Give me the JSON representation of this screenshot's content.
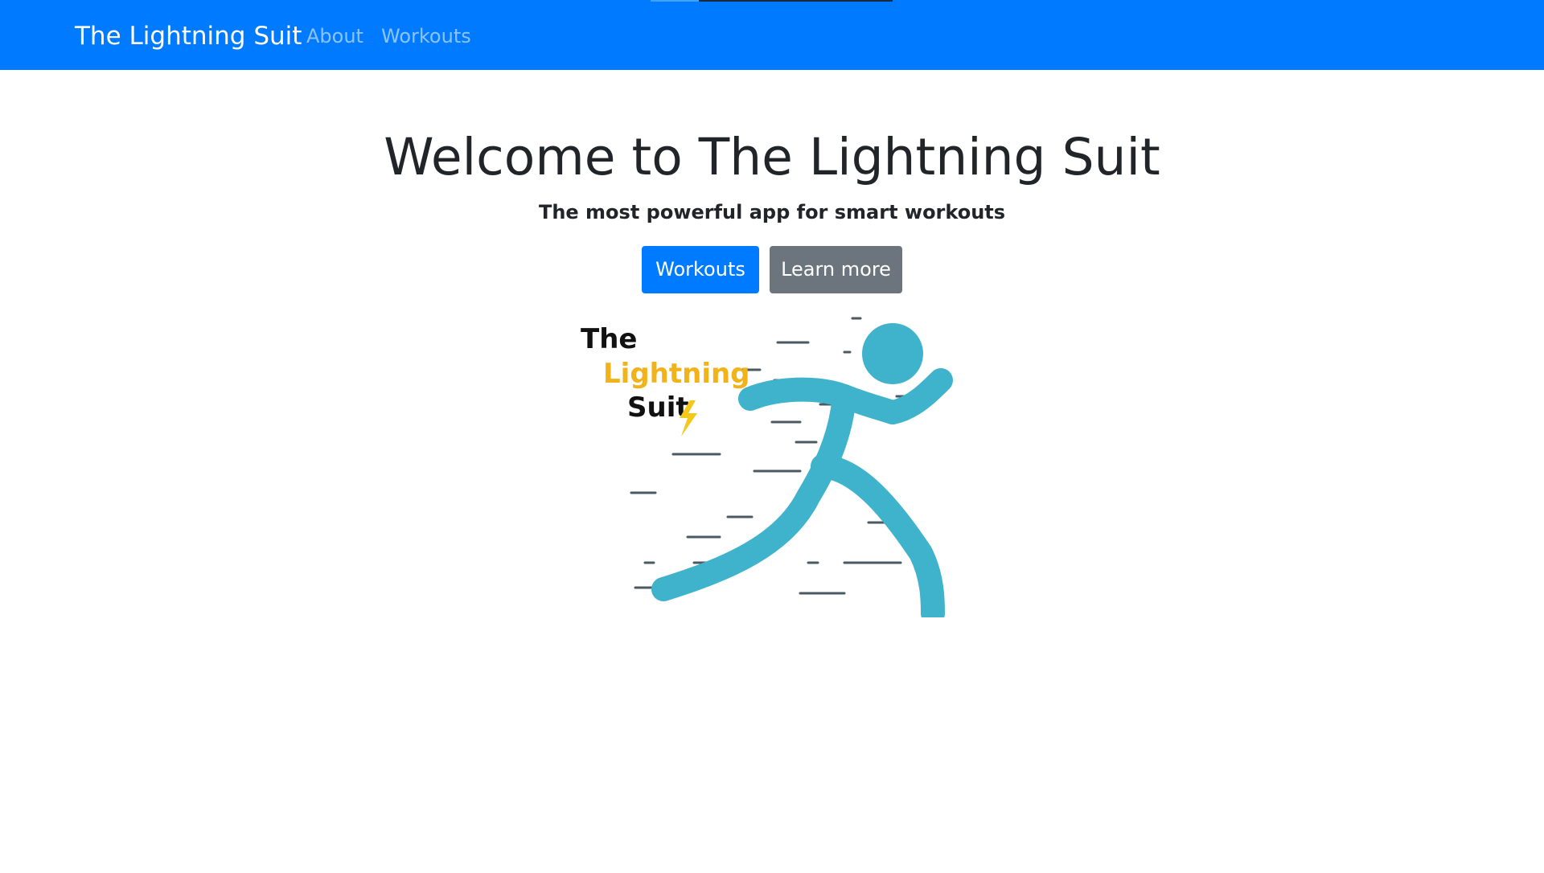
{
  "navbar": {
    "brand": "The Lightning Suit",
    "links": [
      {
        "label": "About"
      },
      {
        "label": "Workouts"
      }
    ],
    "background_color": "#007bff"
  },
  "hero": {
    "title": "Welcome to The Lightning Suit",
    "subtitle": "The most powerful app for smart workouts",
    "buttons": {
      "primary_label": "Workouts",
      "secondary_label": "Learn more"
    }
  },
  "logo": {
    "icon": "running-figure-logo",
    "text_line1": "The",
    "text_line2": "Lightning",
    "text_line3": "Suit",
    "figure_color": "#3fb3cc",
    "lightning_word_color": "#f2b21a",
    "bolt_color": "#f2c81a",
    "speed_line_color": "#4a5a63"
  }
}
